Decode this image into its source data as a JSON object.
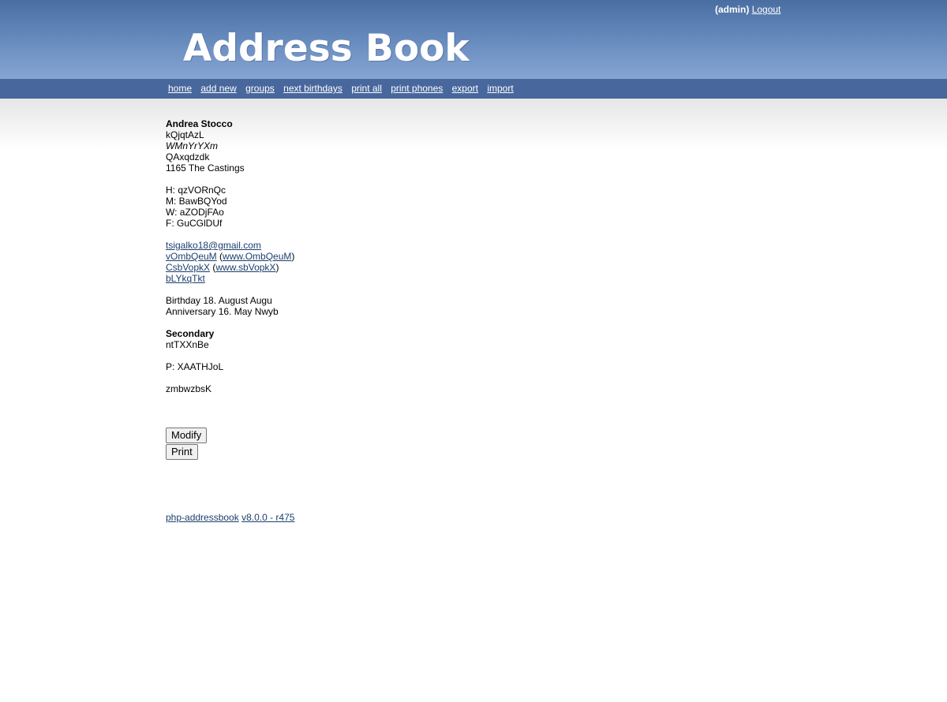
{
  "user": {
    "name": "(admin)",
    "logout_label": "Logout"
  },
  "logo": {
    "text": "Address Book"
  },
  "nav": {
    "items": [
      {
        "label": "home"
      },
      {
        "label": "add new"
      },
      {
        "label": "groups"
      },
      {
        "label": "next birthdays"
      },
      {
        "label": "print all"
      },
      {
        "label": "print phones"
      },
      {
        "label": "export"
      },
      {
        "label": "import"
      }
    ]
  },
  "contact": {
    "name": "Andrea Stocco",
    "nickname": "kQjqtAzL",
    "title": "WMnYrYXm",
    "company": "QAxqdzdk",
    "address": "1165 The Castings",
    "phone_home": "H: qzVORnQc",
    "phone_mobile": "M: BawBQYod",
    "phone_work": "W: aZODjFAo",
    "fax": "F: GuCGlDUf",
    "email1": "tsigalko18@gmail.com",
    "email2": "vOmbQeuM",
    "email2_www": "www.OmbQeuM",
    "email3": "CsbVopkX",
    "email3_www": "www.sbVopkX",
    "homepage": "bLYkqTkt",
    "birthday": "Birthday 18. August Augu",
    "anniversary": "Anniversary 16. May Nwyb",
    "secondary_heading": "Secondary",
    "secondary_address": "ntTXXnBe",
    "secondary_phone": "P: XAATHJoL",
    "notes": "zmbwzbsK"
  },
  "buttons": {
    "modify": "Modify",
    "print": "Print"
  },
  "footer": {
    "app_link": "php-addressbook",
    "version_link": "v8.0.0 - r475"
  },
  "colors": {
    "header_top": "#4a6ea1",
    "header_bottom": "#86a6d3",
    "nav_bar": "#48679c",
    "link": "#1c3f6e"
  }
}
